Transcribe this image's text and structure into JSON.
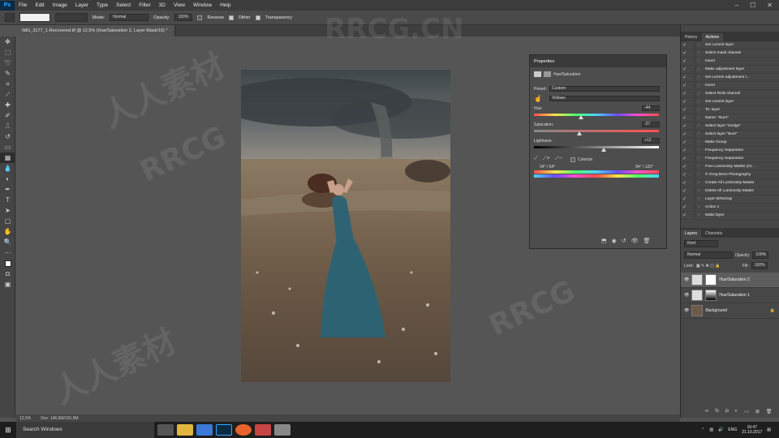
{
  "app": {
    "logo": "Ps"
  },
  "menu": [
    "File",
    "Edit",
    "Image",
    "Layer",
    "Type",
    "Select",
    "Filter",
    "3D",
    "View",
    "Window",
    "Help"
  ],
  "window_controls": [
    "–",
    "☐",
    "✕"
  ],
  "options_bar": {
    "mode_label": "Mode:",
    "mode_value": "Normal",
    "opacity_label": "Opacity:",
    "opacity_value": "100%",
    "reverse_label": "Reverse",
    "dither_label": "Dither",
    "transparency_label": "Transparency"
  },
  "document": {
    "tab_title": "IMG_3177_1-Recovered.tif @ 12,5% (Hue/Saturation 2, Layer Mask/16) *",
    "zoom": "12,5%",
    "doc_size": "Doc: 146,6M/191,5M"
  },
  "watermark_text": [
    "RRCG.CN",
    "人人素材",
    "RRCG",
    "RRCG",
    "人人素材"
  ],
  "properties": {
    "tab": "Properties",
    "adjustment": "Hue/Saturation",
    "preset_label": "Preset:",
    "preset_value": "Custom",
    "channel_value": "Yellows",
    "hue_label": "Hue:",
    "hue_value": "-44",
    "saturation_label": "Saturation:",
    "saturation_value": "-27",
    "lightness_label": "Lightness:",
    "lightness_value": "+12",
    "colorize_label": "Colorize",
    "range_left": "34° / 64°",
    "range_right": "94° \\ 123°",
    "levels": {
      "hue": -44,
      "saturation": -27,
      "lightness": 12
    }
  },
  "history_actions": {
    "tabs": [
      "History",
      "Actions"
    ],
    "rows": [
      "Set current layer",
      "Select mask channel",
      "Invert",
      "Make adjustment layer",
      "Set current adjustment l...",
      "Invert",
      "Select RGB channel",
      "Set current layer",
      "To: layer",
      "Name: \"Burn\"",
      "Select layer \"Dodge\"",
      "Select layer \"Burn\"",
      "Make Group",
      "Frequency Separation",
      "Frequency Separation",
      "Free Luminosity Masks (Gr...",
      "© Greg Benz Photography",
      "Create All Luminosity Masks",
      "Delete All Luminosity Masks",
      "Layer 50%Gray",
      "Action 1",
      "Make layer"
    ]
  },
  "layers_panel": {
    "tabs": [
      "Layers",
      "Channels"
    ],
    "kind_label": "Kind",
    "blend_mode": "Normal",
    "opacity_label": "Opacity:",
    "opacity_value": "100%",
    "lock_label": "Lock:",
    "fill_label": "Fill:",
    "fill_value": "100%",
    "layers": [
      {
        "name": "Hue/Saturation 2",
        "selected": true
      },
      {
        "name": "Hue/Saturation 1",
        "selected": false
      },
      {
        "name": "Background",
        "selected": false
      }
    ]
  },
  "taskbar": {
    "search_placeholder": "Search Windows",
    "language": "ENG",
    "time": "16:47",
    "date": "21.10.2017"
  },
  "colors": {
    "accent": "#31a8ff",
    "panel": "#4d4d4d",
    "dark": "#3a3a3a"
  }
}
